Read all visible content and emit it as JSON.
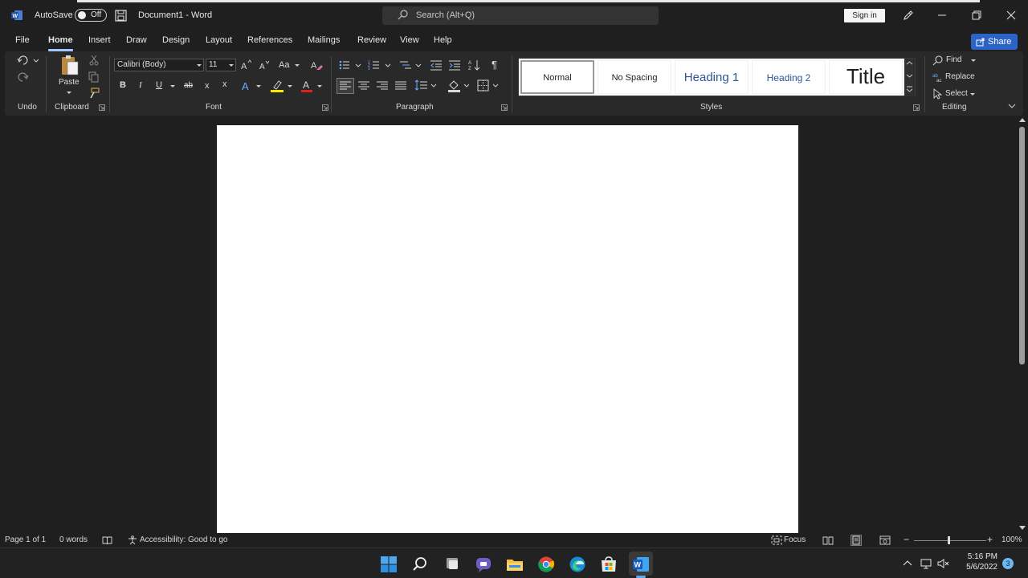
{
  "window": {
    "autosave_label": "AutoSave",
    "autosave_state": "Off",
    "doc_title": "Document1  -  Word",
    "search_placeholder": "Search (Alt+Q)",
    "sign_in": "Sign in"
  },
  "menu": {
    "tabs": [
      "File",
      "Home",
      "Insert",
      "Draw",
      "Design",
      "Layout",
      "References",
      "Mailings",
      "Review",
      "View",
      "Help"
    ],
    "active": "Home",
    "share": "Share"
  },
  "ribbon": {
    "undo_group": "Undo",
    "clipboard_group": "Clipboard",
    "paste": "Paste",
    "font_name": "Calibri (Body)",
    "font_size": "11",
    "change_case": "Aa",
    "bold": "B",
    "italic": "I",
    "underline": "U",
    "strike": "ab",
    "subscript": "x",
    "superscript": "x",
    "font_group": "Font",
    "paragraph_group": "Paragraph",
    "styles_group": "Styles",
    "editing_group": "Editing",
    "styles": [
      "Normal",
      "No Spacing",
      "Heading 1",
      "Heading 2",
      "Title"
    ],
    "find": "Find",
    "replace": "Replace",
    "select": "Select"
  },
  "status": {
    "page": "Page 1 of 1",
    "words": "0 words",
    "accessibility": "Accessibility: Good to go",
    "focus": "Focus",
    "zoom": "100%"
  },
  "taskbar": {
    "time": "5:16 PM",
    "date": "5/6/2022",
    "notifications": "3"
  },
  "colors": {
    "accent": "#2b64c6",
    "active_tab_underline": "#a3c6ff",
    "ribbon_bg": "#292929",
    "window_bg": "#1f1f1f"
  }
}
